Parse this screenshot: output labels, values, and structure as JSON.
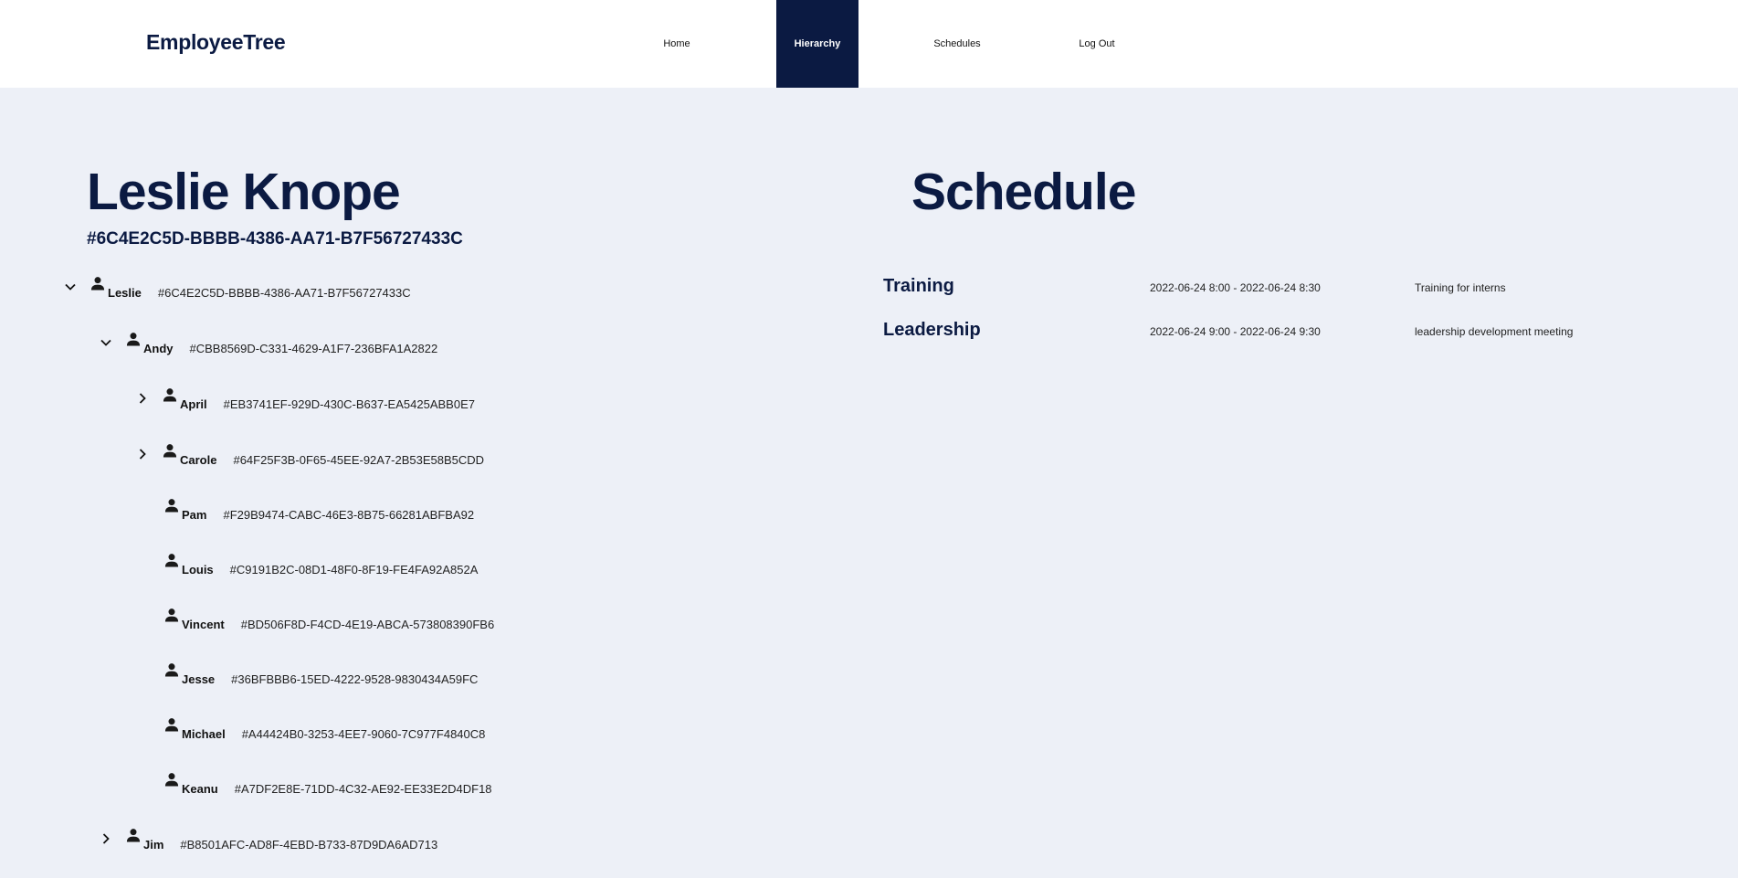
{
  "header": {
    "brand": "EmployeeTree",
    "nav": [
      {
        "label": "Home"
      },
      {
        "label": "Hierarchy"
      },
      {
        "label": "Schedules"
      },
      {
        "label": "Log Out"
      }
    ],
    "active_nav": "Hierarchy"
  },
  "employee": {
    "name": "Leslie Knope",
    "id": "#6C4E2C5D-BBBB-4386-AA71-B7F56727433C"
  },
  "tree": [
    {
      "name": "Leslie",
      "id": "#6C4E2C5D-BBBB-4386-AA71-B7F56727433C",
      "toggle": "expanded",
      "icon": "person-icon"
    },
    {
      "name": "Andy",
      "id": "#CBB8569D-C331-4629-A1F7-236BFA1A2822",
      "toggle": "expanded",
      "icon": "person-icon"
    },
    {
      "name": "April",
      "id": "#EB3741EF-929D-430C-B637-EA5425ABB0E7",
      "toggle": "collapsed",
      "icon": "person-icon"
    },
    {
      "name": "Carole",
      "id": "#64F25F3B-0F65-45EE-92A7-2B53E58B5CDD",
      "toggle": "collapsed",
      "icon": "person-icon"
    },
    {
      "name": "Pam",
      "id": "#F29B9474-CABC-46E3-8B75-66281ABFBA92",
      "toggle": "none",
      "icon": "person-icon"
    },
    {
      "name": "Louis",
      "id": "#C9191B2C-08D1-48F0-8F19-FE4FA92A852A",
      "toggle": "none",
      "icon": "person-icon"
    },
    {
      "name": "Vincent",
      "id": "#BD506F8D-F4CD-4E19-ABCA-573808390FB6",
      "toggle": "none",
      "icon": "person-icon"
    },
    {
      "name": "Jesse",
      "id": "#36BFBBB6-15ED-4222-9528-9830434A59FC",
      "toggle": "none",
      "icon": "person-icon"
    },
    {
      "name": "Michael",
      "id": "#A44424B0-3253-4EE7-9060-7C977F4840C8",
      "toggle": "none",
      "icon": "person-icon"
    },
    {
      "name": "Keanu",
      "id": "#A7DF2E8E-71DD-4C32-AE92-EE33E2D4DF18",
      "toggle": "none",
      "icon": "person-icon"
    },
    {
      "name": "Jim",
      "id": "#B8501AFC-AD8F-4EBD-B733-87D9DA6AD713",
      "toggle": "collapsed",
      "icon": "person-icon"
    }
  ],
  "schedule": {
    "title": "Schedule",
    "items": [
      {
        "title": "Training",
        "time": "2022-06-24 8:00 - 2022-06-24 8:30",
        "description": "Training for interns"
      },
      {
        "title": "Leadership",
        "time": "2022-06-24 9:00 - 2022-06-24 9:30",
        "description": "leadership development meeting"
      }
    ]
  },
  "colors": {
    "brand": "#0b1a42",
    "background": "#edf0f7",
    "header_bg": "#ffffff"
  }
}
